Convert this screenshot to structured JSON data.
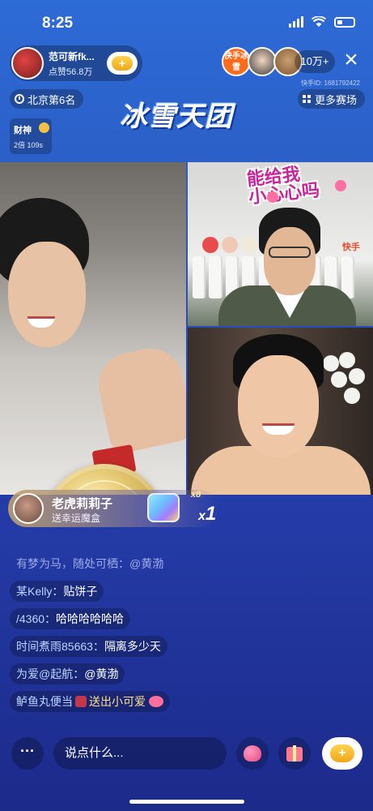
{
  "status_bar": {
    "time": "8:25"
  },
  "host": {
    "name": "范可新fk...",
    "likes": "点赞56.8万",
    "follow_label": "+"
  },
  "viewers": {
    "badge_text": "快手冰雪",
    "count": "10万+",
    "close": "×",
    "kuaishou_id": "快手ID: 1681792422"
  },
  "location": {
    "label": "北京第6名"
  },
  "event_logo": "冰雪天团",
  "more_events": {
    "label": "更多赛场"
  },
  "caishen": {
    "title": "财神",
    "sub": "2倍 109s"
  },
  "video": {
    "sticker_text_line1": "能给我",
    "sticker_text_line2": "小心心吗",
    "watermark": "快手"
  },
  "gift_banner": {
    "user": "老虎莉莉子",
    "action": "送幸运魔盒",
    "multiplier_small": "x8",
    "count_prefix": "x",
    "count": "1"
  },
  "chat": [
    {
      "user": "有梦为马，随处可栖：",
      "message": "@黄渤",
      "faded": true
    },
    {
      "user": "某Kelly：",
      "message": "贴饼子"
    },
    {
      "user": "/4360：",
      "message": "哈哈哈哈哈哈"
    },
    {
      "user": "时间煮雨85663：",
      "message": "隔离多少天"
    },
    {
      "user": "为爱@起航：",
      "message": "@黄渤"
    },
    {
      "user": "鲈鱼丸便当",
      "message": "送出小可爱",
      "gift": true
    }
  ],
  "bottom_bar": {
    "more": "···",
    "comment_placeholder": "说点什么...",
    "share_label": "+"
  },
  "icons": [
    "signal-icon",
    "wifi-icon",
    "battery-icon",
    "clock-icon",
    "grid-icon",
    "heart-icon",
    "present-icon",
    "share-icon",
    "close-icon"
  ]
}
